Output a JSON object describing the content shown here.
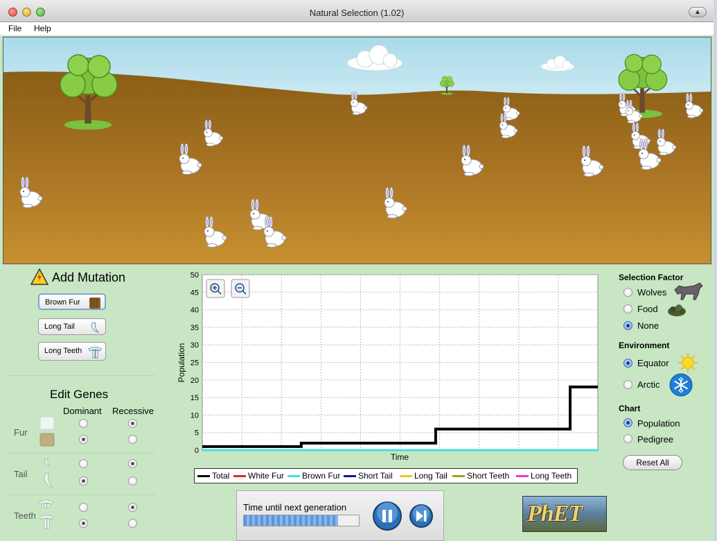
{
  "window": {
    "title": "Natural Selection (1.02)"
  },
  "menu": {
    "file": "File",
    "help": "Help"
  },
  "mutation": {
    "title": "Add Mutation",
    "buttons": {
      "brown_fur": "Brown Fur",
      "long_tail": "Long Tail",
      "long_teeth": "Long Teeth"
    }
  },
  "genes": {
    "title": "Edit Genes",
    "col_dominant": "Dominant",
    "col_recessive": "Recessive",
    "rows": {
      "fur": "Fur",
      "tail": "Tail",
      "teeth": "Teeth"
    }
  },
  "selection": {
    "title": "Selection Factor",
    "options": {
      "wolves": "Wolves",
      "food": "Food",
      "none": "None"
    },
    "selected": "None"
  },
  "environment": {
    "title": "Environment",
    "options": {
      "equator": "Equator",
      "arctic": "Arctic"
    },
    "selected": "Equator"
  },
  "chart_panel": {
    "title": "Chart",
    "options": {
      "population": "Population",
      "pedigree": "Pedigree"
    },
    "selected": "Population"
  },
  "reset_label": "Reset All",
  "timer": {
    "label": "Time until next generation",
    "progress": 0.82
  },
  "logo_text": "PhET",
  "colors": {
    "total": "#000000",
    "white_fur": "#e8261f",
    "brown_fur": "#3fe0e6",
    "short_tail": "#0a14b4",
    "long_tail": "#f5c21a",
    "short_teeth": "#a8a020",
    "long_teeth": "#e63ad6",
    "ground": "#9a6a1e",
    "sky": "#a9dae9",
    "panel": "#c8e6c4"
  },
  "chart_data": {
    "type": "line",
    "xlabel": "Time",
    "ylabel": "Population",
    "ylim": [
      0,
      50
    ],
    "yticks": [
      0,
      5,
      10,
      15,
      20,
      25,
      30,
      35,
      40,
      45,
      50
    ],
    "xlim": [
      0,
      10
    ],
    "series": [
      {
        "name": "Total",
        "x": [
          0,
          2.5,
          2.5,
          5.9,
          5.9,
          9.3,
          9.3,
          10
        ],
        "y": [
          1,
          1,
          2,
          2,
          6,
          6,
          18,
          18
        ]
      },
      {
        "name": "Brown Fur",
        "x": [
          0,
          10
        ],
        "y": [
          0,
          0
        ]
      }
    ],
    "legend": [
      "Total",
      "White Fur",
      "Brown Fur",
      "Short Tail",
      "Long Tail",
      "Short Teeth",
      "Long Teeth"
    ]
  }
}
